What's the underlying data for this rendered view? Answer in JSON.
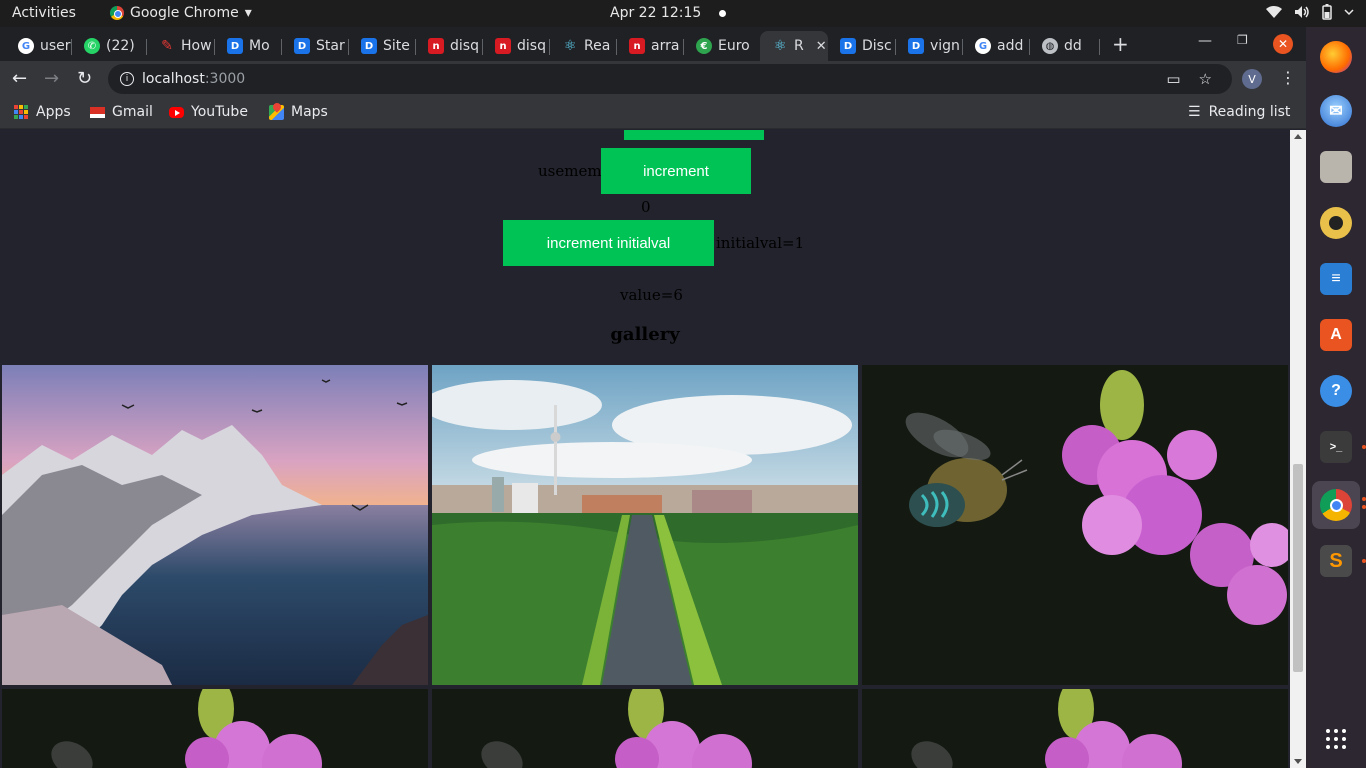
{
  "topbar": {
    "activities": "Activities",
    "app_name": "Google Chrome",
    "app_menu_arrow": "▾",
    "clock": "Apr 22  12:15",
    "icons": [
      "wifi-icon",
      "volume-icon",
      "battery-icon",
      "power-icon"
    ]
  },
  "tabs": [
    {
      "label": "user",
      "favicon": "google"
    },
    {
      "label": "(22)",
      "favicon": "whatsapp"
    },
    {
      "label": "How",
      "favicon": "stackoverflow"
    },
    {
      "label": "Mo",
      "favicon": "dev"
    },
    {
      "label": "Star",
      "favicon": "dev"
    },
    {
      "label": "Site",
      "favicon": "dev"
    },
    {
      "label": "disq",
      "favicon": "netlify"
    },
    {
      "label": "disq",
      "favicon": "netlify"
    },
    {
      "label": "Rea",
      "favicon": "react"
    },
    {
      "label": "arra",
      "favicon": "netlify"
    },
    {
      "label": "Euro",
      "favicon": "euro"
    },
    {
      "label": "R",
      "favicon": "react",
      "active": true
    },
    {
      "label": "Disc",
      "favicon": "dev"
    },
    {
      "label": "vign",
      "favicon": "dev"
    },
    {
      "label": "add",
      "favicon": "google"
    },
    {
      "label": "dd",
      "favicon": "globe"
    }
  ],
  "toolbar": {
    "url_host": "localhost",
    "url_port": ":3000",
    "profile_initial": "V"
  },
  "bookmarks": [
    {
      "label": "Apps",
      "icon": "apps-icon"
    },
    {
      "label": "Gmail",
      "icon": "gmail-icon"
    },
    {
      "label": "YouTube",
      "icon": "youtube-icon"
    },
    {
      "label": "Maps",
      "icon": "maps-icon"
    }
  ],
  "reading_list": "Reading list",
  "page": {
    "usememo_label": "usememo",
    "increment_button": "increment",
    "count_value": "0",
    "increment_initial_button": "increment initialval",
    "initialval_text": "initialval=1",
    "value_text": "value=6",
    "gallery_title": "gallery",
    "gallery_images": [
      {
        "subject": "snowy mountain coast at sunset"
      },
      {
        "subject": "Berlin city skyline with TV tower and park"
      },
      {
        "subject": "bee approaching pink flower"
      },
      {
        "subject": "bee approaching pink flower"
      },
      {
        "subject": "bee approaching pink flower"
      },
      {
        "subject": "bee approaching pink flower"
      }
    ]
  },
  "dock": [
    "firefox-icon",
    "thunderbird-icon",
    "files-icon",
    "rhythmbox-icon",
    "writer-icon",
    "software-icon",
    "help-icon",
    "terminal-icon",
    "chrome-icon",
    "sublime-icon",
    "show-apps-icon"
  ],
  "colors": {
    "page_bg": "#22232c",
    "button_green": "#00c356",
    "ubuntu_orange": "#e95420"
  }
}
